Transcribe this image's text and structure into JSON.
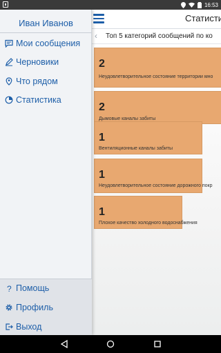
{
  "status_bar": {
    "time": "16:53"
  },
  "drawer": {
    "user_name": "Иван Иванов",
    "items": [
      {
        "label": "Мои сообщения",
        "icon": "message-icon"
      },
      {
        "label": "Черновики",
        "icon": "pencil-icon"
      },
      {
        "label": "Что рядом",
        "icon": "location-pin-icon"
      },
      {
        "label": "Статистика",
        "icon": "stats-icon"
      }
    ],
    "bottom_items": [
      {
        "label": "Помощь",
        "icon": "help-icon"
      },
      {
        "label": "Профиль",
        "icon": "gear-icon"
      },
      {
        "label": "Выход",
        "icon": "logout-icon"
      }
    ]
  },
  "header": {
    "title": "Статисти"
  },
  "subheader": {
    "title": "Топ 5 категорий сообщений по ко"
  },
  "categories": [
    {
      "count": "2",
      "label": "Неудовлетворительное состояние территории мно"
    },
    {
      "count": "2",
      "label": "Дымовые каналы забиты"
    },
    {
      "count": "1",
      "label": "Вентиляционные каналы забиты"
    },
    {
      "count": "1",
      "label": "Неудовлетворительное состояние дорожного покр"
    },
    {
      "count": "1",
      "label": "Плохое качество холодного водоснабжения"
    }
  ],
  "colors": {
    "accent": "#1d5ea8",
    "card": "#e8a870"
  }
}
